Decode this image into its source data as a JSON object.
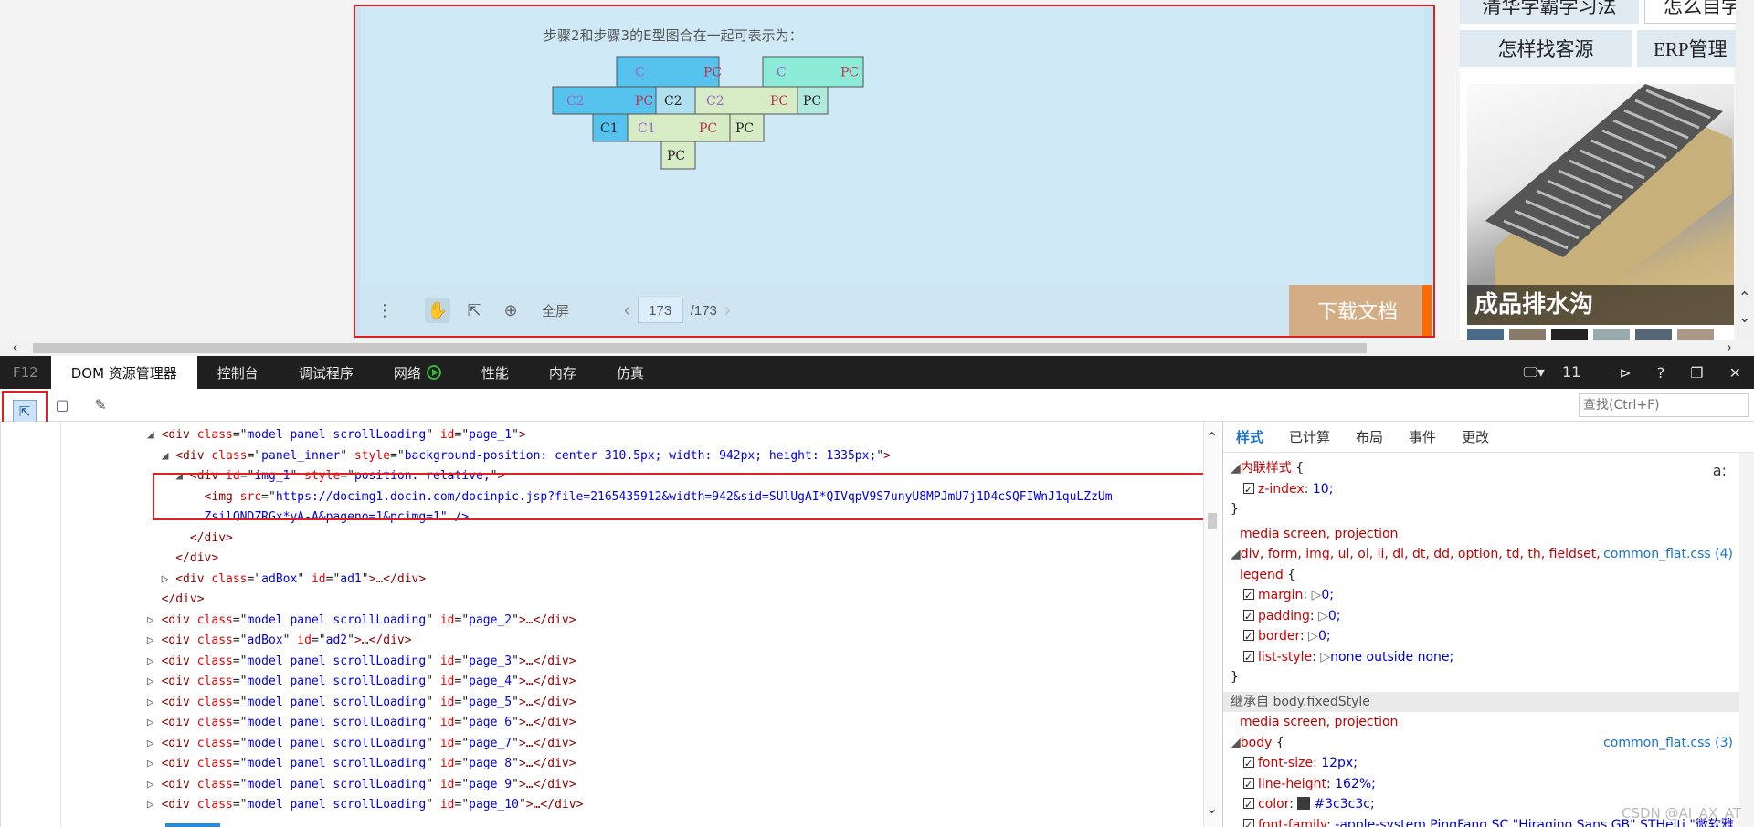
{
  "page": {
    "diagram_heading": "步骤2和步骤3的E型图合在一起可表示为：",
    "blocks": [
      "C",
      "PC",
      "C",
      "PC",
      "C2",
      "PC",
      "C2",
      "C2",
      "PC",
      "PC",
      "C1",
      "C1",
      "PC",
      "PC",
      "PC"
    ],
    "toolbar": {
      "fullscreen_label": "全屏",
      "current_page": "173",
      "total_pages": "/173",
      "download_label": "下载文档"
    }
  },
  "ads": {
    "link_1": "清华学霸学习法",
    "link_2": "怎么自学",
    "link_3": "怎样找客源",
    "link_4": "ERP管理",
    "image_caption": "成品排水沟"
  },
  "devtools": {
    "f12_label": "F12",
    "tabs": [
      "DOM 资源管理器",
      "控制台",
      "调试程序",
      "网络",
      "性能",
      "内存",
      "仿真"
    ],
    "device_count": "11",
    "find_placeholder": "查找(Ctrl+F)",
    "dom_lines": [
      {
        "indent": 6,
        "tri": "◢",
        "tag": "div",
        "attrs": [
          [
            "class",
            "model panel scrollLoading"
          ],
          [
            "id",
            "page_1"
          ]
        ],
        "close": ">"
      },
      {
        "indent": 7,
        "tri": "◢",
        "tag": "div",
        "attrs": [
          [
            "class",
            "panel_inner"
          ],
          [
            "style",
            "background-position: center 310.5px; width: 942px; height: 1335px;"
          ]
        ],
        "close": ">"
      },
      {
        "indent": 8,
        "tri": "◢",
        "tag": "div",
        "attrs": [
          [
            "id",
            "img_1"
          ],
          [
            "style",
            "position: relative;"
          ]
        ],
        "close": ">"
      },
      {
        "indent": 9,
        "tri": "",
        "tag": "img",
        "attrs": [
          [
            "src",
            "https://docimg1.docin.com/docinpic.jsp?file=2165435912&width=942&sid=SUlUgAI*QIVqpV9S7unyU8MPJmU7j1D4cSQFIWnJ1quLZzUm"
          ]
        ],
        "close": ""
      },
      {
        "indent": 9,
        "tri": "",
        "text": "ZsilQNDZRGx*yA-A&pageno=1&pcimg=1\" />",
        "plain": true
      },
      {
        "indent": 8,
        "tri": "",
        "text": "</div>",
        "plain": true
      },
      {
        "indent": 7,
        "tri": "",
        "text": "</div>",
        "plain": true
      },
      {
        "indent": 7,
        "tri": "▷",
        "tag": "div",
        "attrs": [
          [
            "class",
            "adBox"
          ],
          [
            "id",
            "ad1"
          ]
        ],
        "close": ">…</div>"
      },
      {
        "indent": 6,
        "tri": "",
        "text": "</div>",
        "plain": true
      },
      {
        "indent": 6,
        "tri": "▷",
        "tag": "div",
        "attrs": [
          [
            "class",
            "model panel scrollLoading"
          ],
          [
            "id",
            "page_2"
          ]
        ],
        "close": ">…</div>"
      },
      {
        "indent": 6,
        "tri": "▷",
        "tag": "div",
        "attrs": [
          [
            "class",
            "adBox"
          ],
          [
            "id",
            "ad2"
          ]
        ],
        "close": ">…</div>"
      },
      {
        "indent": 6,
        "tri": "▷",
        "tag": "div",
        "attrs": [
          [
            "class",
            "model panel scrollLoading"
          ],
          [
            "id",
            "page_3"
          ]
        ],
        "close": ">…</div>"
      },
      {
        "indent": 6,
        "tri": "▷",
        "tag": "div",
        "attrs": [
          [
            "class",
            "model panel scrollLoading"
          ],
          [
            "id",
            "page_4"
          ]
        ],
        "close": ">…</div>"
      },
      {
        "indent": 6,
        "tri": "▷",
        "tag": "div",
        "attrs": [
          [
            "class",
            "model panel scrollLoading"
          ],
          [
            "id",
            "page_5"
          ]
        ],
        "close": ">…</div>"
      },
      {
        "indent": 6,
        "tri": "▷",
        "tag": "div",
        "attrs": [
          [
            "class",
            "model panel scrollLoading"
          ],
          [
            "id",
            "page_6"
          ]
        ],
        "close": ">…</div>"
      },
      {
        "indent": 6,
        "tri": "▷",
        "tag": "div",
        "attrs": [
          [
            "class",
            "model panel scrollLoading"
          ],
          [
            "id",
            "page_7"
          ]
        ],
        "close": ">…</div>"
      },
      {
        "indent": 6,
        "tri": "▷",
        "tag": "div",
        "attrs": [
          [
            "class",
            "model panel scrollLoading"
          ],
          [
            "id",
            "page_8"
          ]
        ],
        "close": ">…</div>"
      },
      {
        "indent": 6,
        "tri": "▷",
        "tag": "div",
        "attrs": [
          [
            "class",
            "model panel scrollLoading"
          ],
          [
            "id",
            "page_9"
          ]
        ],
        "close": ">…</div>"
      },
      {
        "indent": 6,
        "tri": "▷",
        "tag": "div",
        "attrs": [
          [
            "class",
            "model panel scrollLoading"
          ],
          [
            "id",
            "page_10"
          ]
        ],
        "close": ">…</div>"
      }
    ],
    "styles_tabs": [
      "样式",
      "已计算",
      "布局",
      "事件",
      "更改"
    ],
    "styles": {
      "inline_selector": "内联样式",
      "zindex_prop": "z-index",
      "zindex_val": "10;",
      "media_1": "media screen, projection",
      "reset_selector": "div, form, img, ul, ol, li, dl, dt, dd, option, td, th, fieldset,",
      "reset_selector_2": "legend",
      "reset_source": "common_flat.css (4)",
      "props_reset": [
        [
          "margin",
          "0;"
        ],
        [
          "padding",
          "0;"
        ],
        [
          "border",
          "0;"
        ],
        [
          "list-style",
          "none outside none;"
        ]
      ],
      "inherit_label": "继承自",
      "inherit_from": "body.fixedStyle",
      "media_2": "media screen, projection",
      "body_selector": "body",
      "body_source": "common_flat.css (3)",
      "body_props": [
        [
          "font-size",
          "12px;"
        ],
        [
          "line-height",
          "162%;"
        ],
        [
          "color",
          "#3c3c3c;"
        ],
        [
          "font-family",
          "-apple-system,PingFang SC,\"Hiragino Sans GB\",STHeiti,\"微软雅"
        ]
      ],
      "aa_label": "a:"
    },
    "watermark": "CSDN @AI_AX_AT"
  }
}
